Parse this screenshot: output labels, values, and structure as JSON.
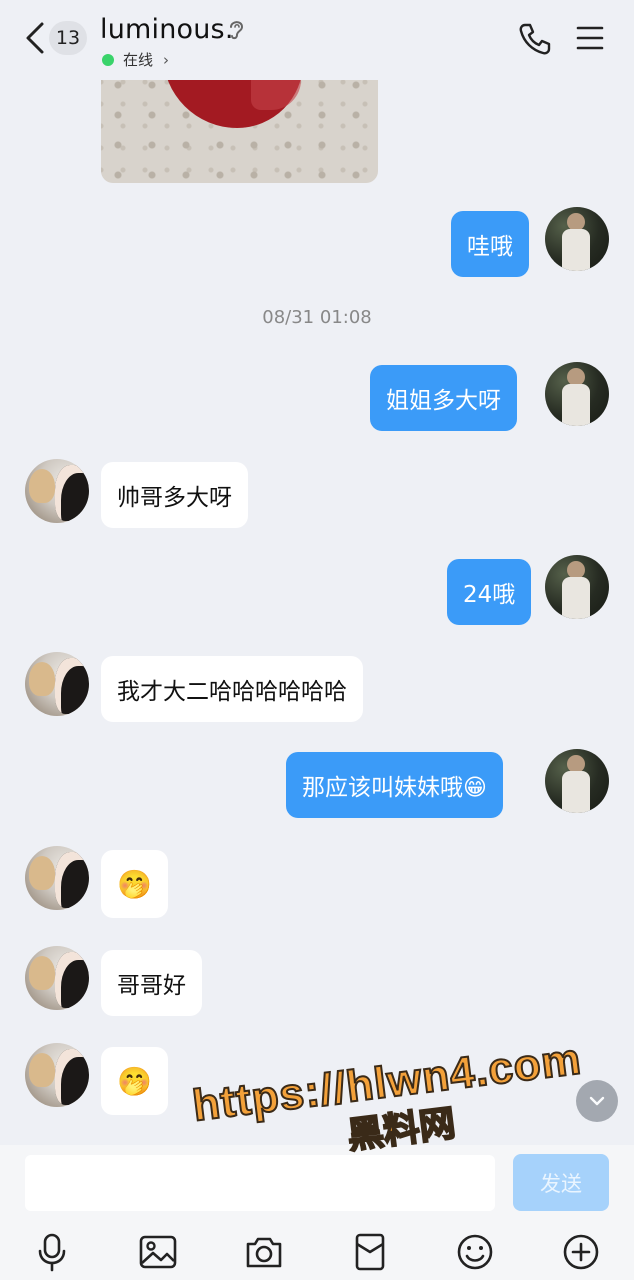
{
  "header": {
    "unread_count": "13",
    "contact_name": "luminous.",
    "status_text": "在线",
    "status_color": "#39d36a"
  },
  "icons": [
    "back-icon",
    "ear-icon",
    "phone-icon",
    "menu-icon",
    "mic-icon",
    "image-icon",
    "camera-icon",
    "red-packet-icon",
    "emoji-icon",
    "plus-icon",
    "chevron-down-icon"
  ],
  "timestamp": "08/31 01:08",
  "messages": [
    {
      "from": "me",
      "text": "哇哦"
    },
    {
      "from": "me",
      "text": "姐姐多大呀"
    },
    {
      "from": "her",
      "text": "帅哥多大呀"
    },
    {
      "from": "me",
      "text": "24哦"
    },
    {
      "from": "her",
      "text": "我才大二哈哈哈哈哈哈"
    },
    {
      "from": "me",
      "text": "那应该叫妹妹哦😁"
    },
    {
      "from": "her",
      "text": "🤭"
    },
    {
      "from": "her",
      "text": "哥哥好"
    },
    {
      "from": "her",
      "text": "🤭"
    }
  ],
  "composer": {
    "input_value": "",
    "send_label": "发送"
  },
  "colors": {
    "outgoing_bubble": "#3b9bf8",
    "incoming_bubble": "#ffffff",
    "background": "#eef0f5",
    "send_button": "#a6d2fb"
  },
  "watermark": {
    "url": "https://hlwn4.com",
    "site": "黑料网"
  }
}
